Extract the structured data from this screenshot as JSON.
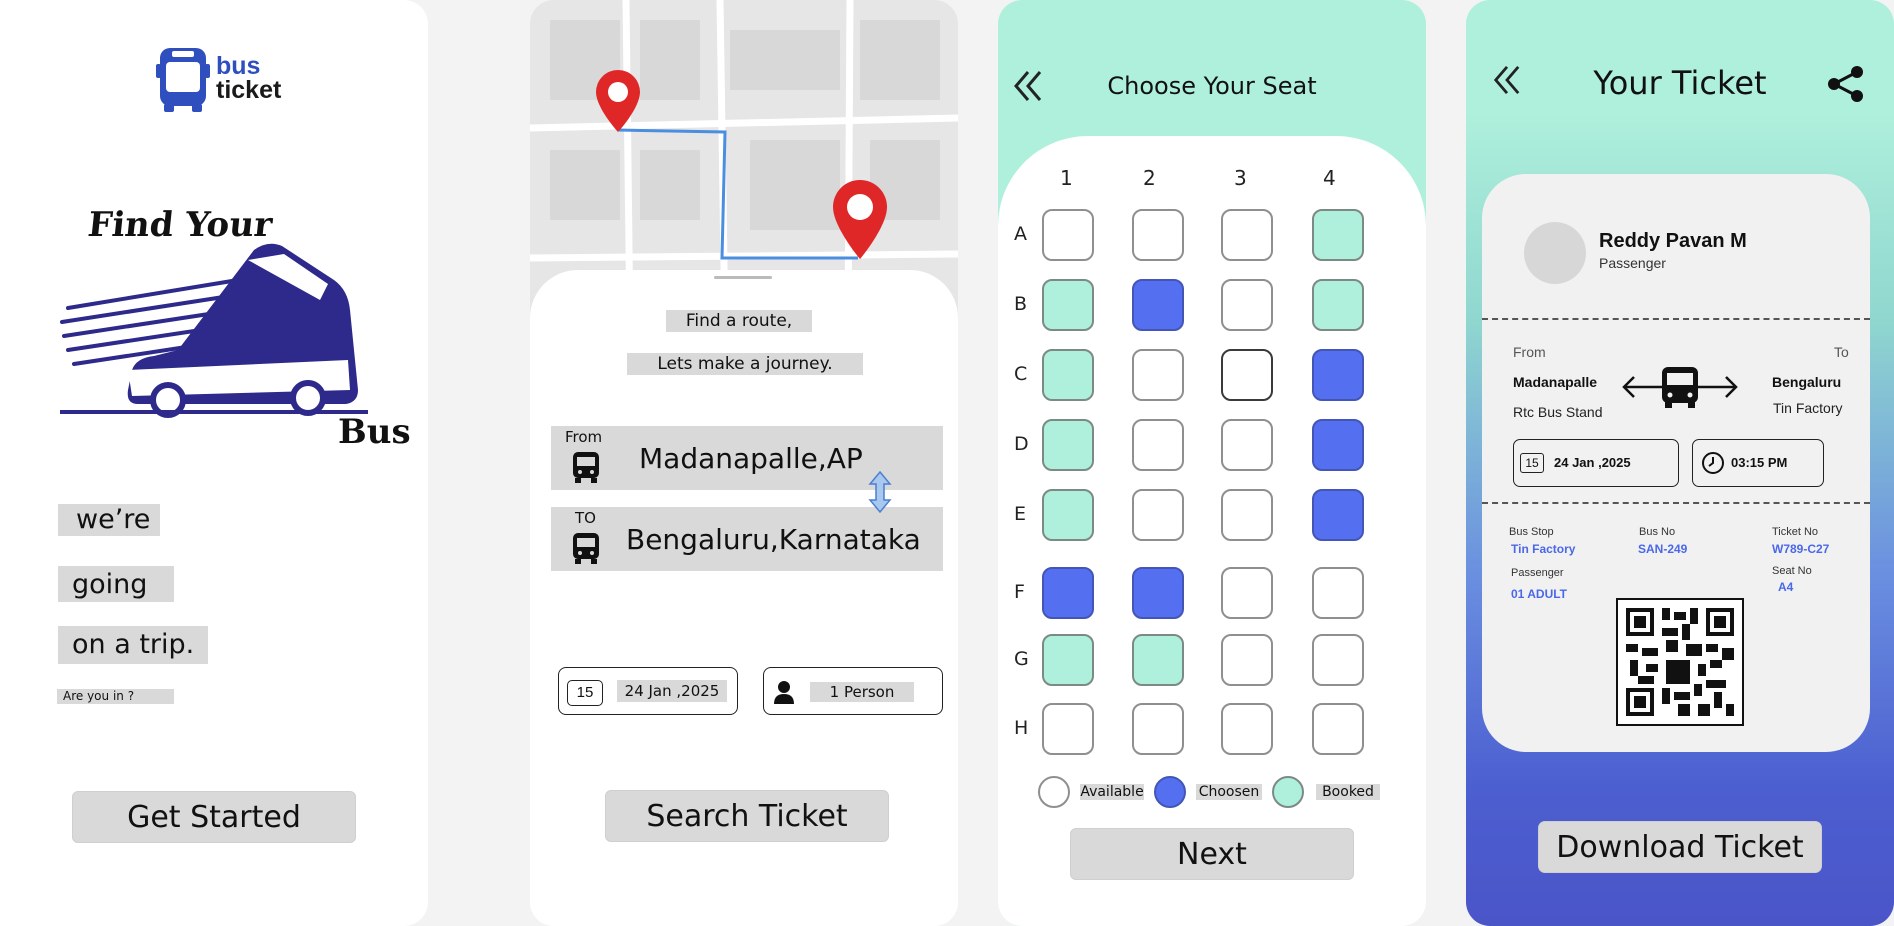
{
  "colors": {
    "mint": "#aff0dc",
    "chosen": "#5470f0",
    "navy": "#2d2a8c",
    "gray_label": "#d9d9d9"
  },
  "onboarding": {
    "logo_top": "bus",
    "logo_bottom": "ticket",
    "hero_line1": "Find Your",
    "hero_line2": "Bus",
    "tag1": "we’re",
    "tag2": "going",
    "tag3": "on a trip.",
    "question": "Are you in ?",
    "cta": "Get Started"
  },
  "search": {
    "headline1": "Find a route,",
    "headline2": "Lets make a journey.",
    "from_label": "From",
    "from_value": "Madanapalle,AP",
    "to_label": "TO",
    "to_value": "Bengaluru,Karnataka",
    "calendar_day": "15",
    "date": "24 Jan ,2025",
    "passengers": "1 Person",
    "cta": "Search Ticket",
    "icons": [
      "map-pin-icon",
      "bus-icon",
      "swap-vertical-icon",
      "calendar-icon",
      "person-icon"
    ]
  },
  "seats": {
    "title": "Choose Your Seat",
    "columns": [
      "1",
      "2",
      "3",
      "4"
    ],
    "rows": [
      {
        "label": "A",
        "states": [
          "available",
          "available",
          "available",
          "booked"
        ]
      },
      {
        "label": "B",
        "states": [
          "booked",
          "chosen",
          "available",
          "booked"
        ]
      },
      {
        "label": "C",
        "states": [
          "booked",
          "available",
          "available",
          "chosen"
        ]
      },
      {
        "label": "D",
        "states": [
          "booked",
          "available",
          "available",
          "chosen"
        ]
      },
      {
        "label": "E",
        "states": [
          "booked",
          "available",
          "available",
          "chosen"
        ]
      },
      {
        "label": "F",
        "states": [
          "chosen",
          "chosen",
          "available",
          "available"
        ]
      },
      {
        "label": "G",
        "states": [
          "booked",
          "booked",
          "available",
          "available"
        ]
      },
      {
        "label": "H",
        "states": [
          "available",
          "available",
          "available",
          "available"
        ]
      }
    ],
    "legend": {
      "available": "Available",
      "chosen": "Choosen",
      "booked": "Booked"
    },
    "cta": "Next"
  },
  "ticket": {
    "title": "Your Ticket",
    "passenger_name": "Reddy Pavan M",
    "passenger_role": "Passenger",
    "from_label": "From",
    "to_label": "To",
    "from_city": "Madanapalle",
    "from_stop": "Rtc Bus Stand",
    "to_city": "Bengaluru",
    "to_stop": "Tin Factory",
    "calendar_day": "15",
    "date": "24 Jan ,2025",
    "time": "03:15 PM",
    "bus_stop_label": "Bus Stop",
    "bus_stop": "Tin Factory",
    "bus_no_label": "Bus No",
    "bus_no": "SAN-249",
    "ticket_no_label": "Ticket No",
    "ticket_no": "W789-C27",
    "passenger_label": "Passenger",
    "passenger_count": "01 ADULT",
    "seat_no_label": "Seat No",
    "seat_no": "A4",
    "cta": "Download Ticket"
  }
}
